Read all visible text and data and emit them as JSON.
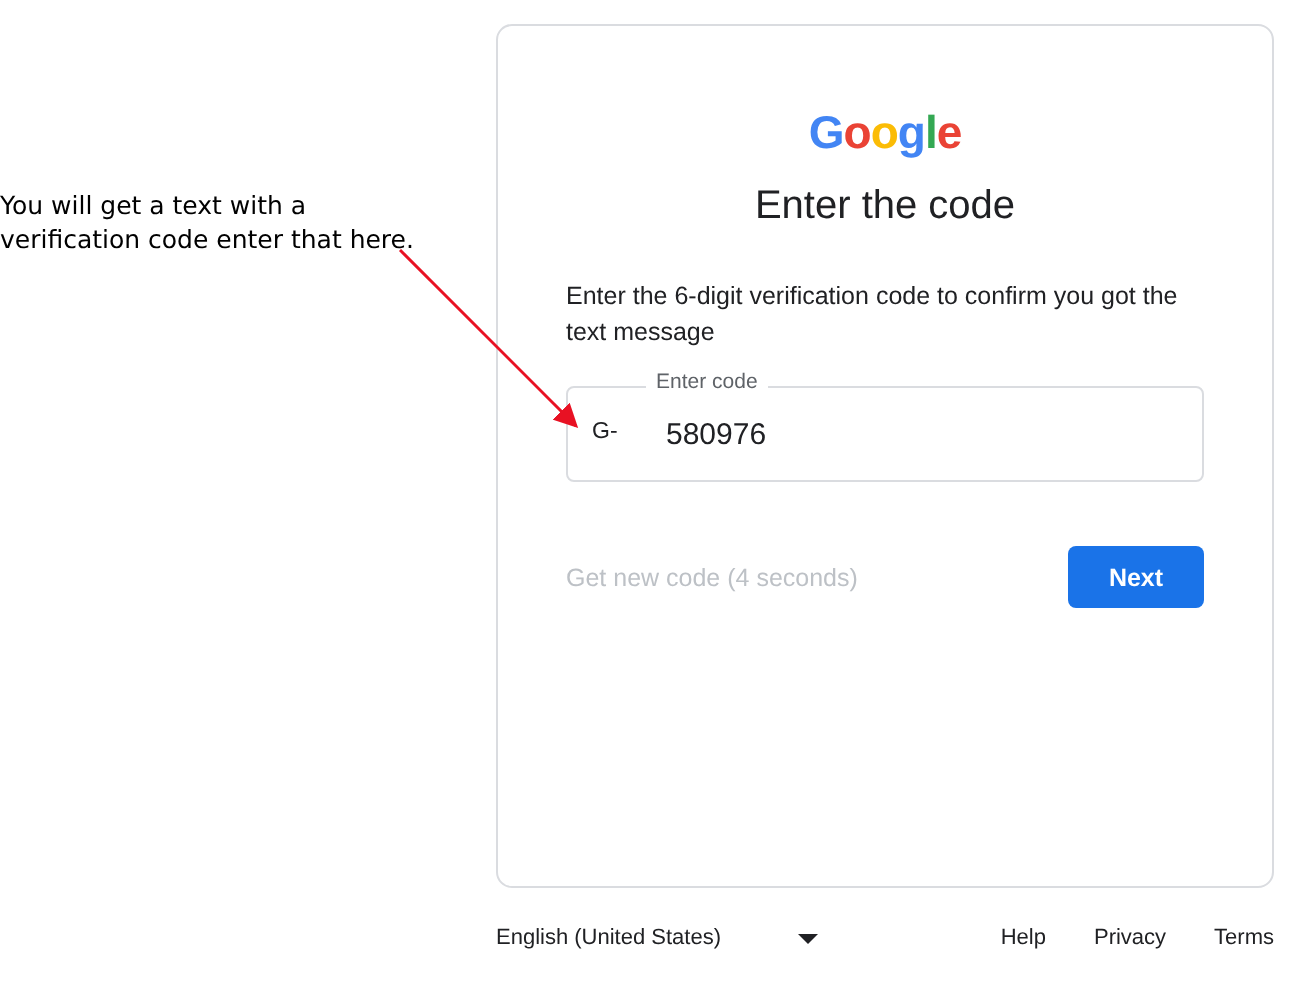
{
  "annotation": {
    "note": "You will get a text with a verification code enter that here."
  },
  "card": {
    "logo": "Google",
    "title": "Enter the code",
    "description": "Enter the 6-digit verification code to confirm you got the text message",
    "code_field": {
      "label": "Enter code",
      "prefix": "G-",
      "value": "580976"
    },
    "resend_link": {
      "label": "Get new code (4 seconds)",
      "disabled": true
    },
    "next_button": {
      "label": "Next"
    }
  },
  "footer": {
    "language": "English (United States)",
    "links": [
      "Help",
      "Privacy",
      "Terms"
    ]
  }
}
